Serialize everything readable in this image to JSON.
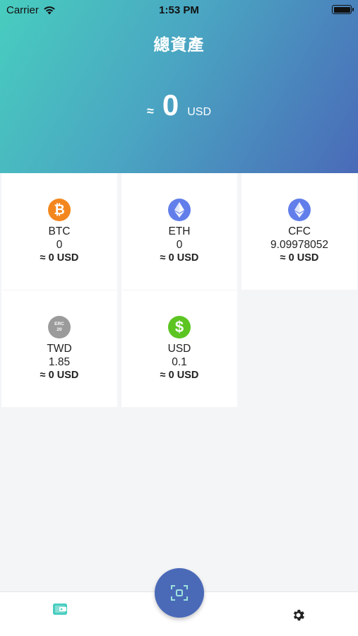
{
  "status_bar": {
    "carrier": "Carrier",
    "time": "1:53 PM"
  },
  "header": {
    "title": "總資產",
    "approx_symbol": "≈",
    "total_value": "0",
    "total_unit": "USD"
  },
  "assets": [
    {
      "name": "BTC",
      "amount": "0",
      "usd": "≈ 0 USD",
      "icon": "bitcoin-icon"
    },
    {
      "name": "ETH",
      "amount": "0",
      "usd": "≈ 0 USD",
      "icon": "ethereum-icon"
    },
    {
      "name": "CFC",
      "amount": "9.09978052",
      "usd": "≈ 0 USD",
      "icon": "ethereum-icon"
    },
    {
      "name": "TWD",
      "amount": "1.85",
      "usd": "≈ 0 USD",
      "icon": "erc20-token-icon"
    },
    {
      "name": "USD",
      "amount": "0.1",
      "usd": "≈ 0 USD",
      "icon": "dollar-icon"
    }
  ],
  "icon_texts": {
    "btc_glyph": "₿",
    "erc20_top": "ERC",
    "erc20_bottom": "20",
    "dollar_glyph": "$"
  },
  "colors": {
    "gradient_start": "#48cdbf",
    "gradient_end": "#4a6ab8",
    "btc": "#f3871e",
    "eth": "#627eea",
    "erc20": "#9b9b9b",
    "usd": "#5cc521",
    "wallet_tab": "#48cdbf",
    "scan_button": "#4a6ab8"
  }
}
